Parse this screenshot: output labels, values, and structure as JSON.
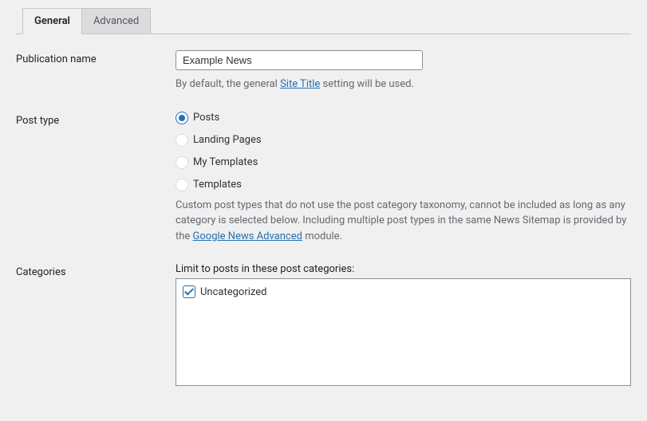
{
  "tabs": {
    "general": "General",
    "advanced": "Advanced"
  },
  "sections": {
    "publication": {
      "label": "Publication name",
      "value": "Example News",
      "help_prefix": "By default, the general ",
      "help_link": "Site Title",
      "help_suffix": " setting will be used."
    },
    "post_type": {
      "label": "Post type",
      "options": [
        {
          "label": "Posts",
          "checked": true,
          "disabled": false
        },
        {
          "label": "Landing Pages",
          "checked": false,
          "disabled": true
        },
        {
          "label": "My Templates",
          "checked": false,
          "disabled": true
        },
        {
          "label": "Templates",
          "checked": false,
          "disabled": true
        }
      ],
      "help_prefix": "Custom post types that do not use the post category taxonomy, cannot be included as long as any category is selected below. Including multiple post types in the same News Sitemap is provided by the ",
      "help_link": "Google News Advanced",
      "help_suffix": " module."
    },
    "categories": {
      "label": "Categories",
      "sublabel": "Limit to posts in these post categories:",
      "items": [
        {
          "label": "Uncategorized",
          "checked": true
        }
      ]
    }
  }
}
